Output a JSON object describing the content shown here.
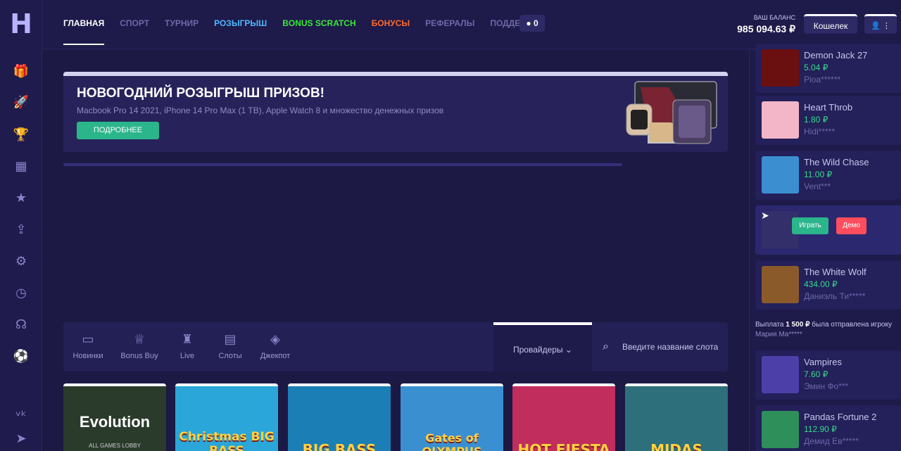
{
  "header": {
    "nav": [
      {
        "label": "ГЛАВНАЯ",
        "color": "#ffffff",
        "active": true
      },
      {
        "label": "СПОРТ",
        "color": "#6e68a8"
      },
      {
        "label": "ТУРНИР",
        "color": "#6e68a8"
      },
      {
        "label": "РОЗЫГРЫШ",
        "color": "#4db8ff"
      },
      {
        "label": "BONUS SCRATCH",
        "color": "#39e83a"
      },
      {
        "label": "БОНУСЫ",
        "color": "#ff6a2b"
      },
      {
        "label": "РЕФЕРАЛЫ",
        "color": "#6e68a8"
      },
      {
        "label": "ПОДДЕРЖКА",
        "color": "#6e68a8"
      }
    ],
    "counter": "0",
    "balance_label": "ВАШ БАЛАНС",
    "balance_value": "985 094.63 ₽",
    "wallet_label": "Кошелек",
    "user_icon": "user-icon",
    "menu_icon": "kebab-icon"
  },
  "sidebar": {
    "logo": "H",
    "icons": [
      "gift-icon",
      "rocket-icon",
      "trophy-icon",
      "gift-box-icon",
      "star-icon",
      "share-icon",
      "settings-icon",
      "clock-icon",
      "headset-icon",
      "soccer-ball-icon",
      "vk-icon",
      "telegram-icon"
    ]
  },
  "promo": {
    "title": "НОВОГОДНИЙ РОЗЫГРЫШ ПРИЗОВ!",
    "subtitle": "Macbook Pro 14 2021, iPhone 14 Pro Max (1 TB), Apple Watch 8 и множество денежных призов",
    "button": "ПОДРОБНЕЕ"
  },
  "filters": {
    "categories": [
      {
        "label": "Новинки",
        "icon": "new-badge-icon"
      },
      {
        "label": "Bonus Buy",
        "icon": "bonus-buy-icon"
      },
      {
        "label": "Live",
        "icon": "live-icon"
      },
      {
        "label": "Слоты",
        "icon": "slot-machine-icon"
      },
      {
        "label": "Джекпот",
        "icon": "jackpot-icon"
      }
    ],
    "providers": "Провайдеры",
    "search_placeholder": "Введите название слота"
  },
  "games": [
    {
      "title": "Evolution",
      "subtitle": "ALL GAMES LOBBY",
      "color": "#2a3b2c"
    },
    {
      "title": "Christmas BIG BASS",
      "color": "#2aa6d8"
    },
    {
      "title": "BIG BASS",
      "color": "#1b7fb5"
    },
    {
      "title": "Gates of OLYMPUS",
      "color": "#3a8fd1"
    },
    {
      "title": "HOT FIESTA",
      "color": "#c12d5d"
    },
    {
      "title": "MIDAS",
      "color": "#2d6f7a"
    }
  ],
  "feed": [
    {
      "name": "Demon Jack 27",
      "amount": "5.04 ₽",
      "user": "Pioa******",
      "color": "#6b1010"
    },
    {
      "name": "Heart Throb",
      "amount": "1.80 ₽",
      "user": "Hidi*****",
      "color": "#f3b6c8"
    },
    {
      "name": "The Wild Chase",
      "amount": "11.00 ₽",
      "user": "Vent***",
      "color": "#3b8fd1"
    },
    {
      "hover": true,
      "play": "Играть",
      "demo": "Демо",
      "color": "#3a3566"
    },
    {
      "name": "The White Wolf",
      "amount": "434.00 ₽",
      "user": "Даниэль Ти*****",
      "color": "#8b5a2b"
    },
    {
      "note": true,
      "text_pre": "Выплата",
      "text_amount": "1 500 ₽",
      "text_post": "была отправлена игроку",
      "text_user": "Мария Ма*****"
    },
    {
      "name": "Vampires",
      "amount": "7.60 ₽",
      "user": "Эмин Фо***",
      "color": "#4d3fa8"
    },
    {
      "name": "Pandas Fortune 2",
      "amount": "112.90 ₽",
      "user": "Демид Ев*****",
      "color": "#2f8f5a"
    }
  ]
}
